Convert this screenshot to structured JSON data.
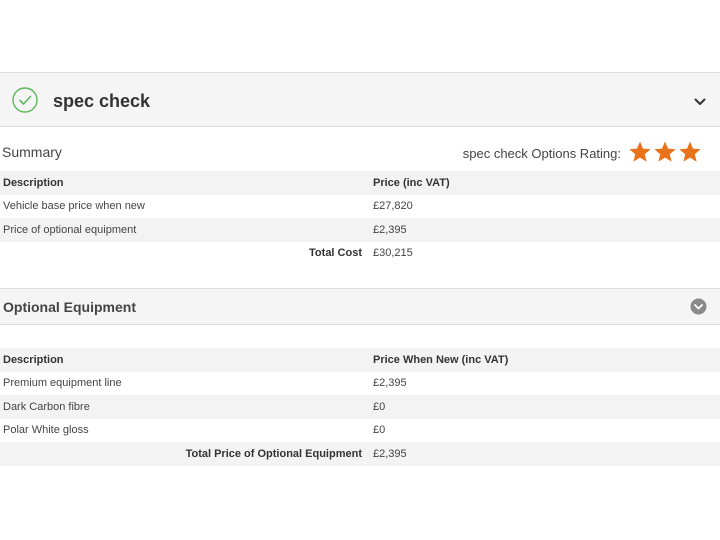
{
  "spec_check": {
    "title": "spec check",
    "icons": {
      "status": "check-circle-icon",
      "toggle": "chevron-down-icon"
    },
    "accent_color": "#5cb85c"
  },
  "summary": {
    "label": "Summary",
    "rating_label": "spec check Options Rating:",
    "rating_stars": 3,
    "star_color": "#e8731a",
    "columns": {
      "description": "Description",
      "price": "Price (inc VAT)"
    },
    "rows": [
      {
        "description": "Vehicle base price when new",
        "price": "£27,820"
      },
      {
        "description": "Price of optional equipment",
        "price": "£2,395"
      }
    ],
    "total": {
      "label": "Total Cost",
      "value": "£30,215"
    }
  },
  "optional_equipment": {
    "title": "Optional Equipment",
    "toggle_icon": "chevron-down-circle-icon",
    "columns": {
      "description": "Description",
      "price": "Price When New (inc VAT)"
    },
    "rows": [
      {
        "description": "Premium equipment line",
        "price": "£2,395"
      },
      {
        "description": "Dark Carbon fibre",
        "price": "£0"
      },
      {
        "description": "Polar White gloss",
        "price": "£0"
      }
    ],
    "total": {
      "label": "Total Price of Optional Equipment",
      "value": "£2,395"
    }
  }
}
